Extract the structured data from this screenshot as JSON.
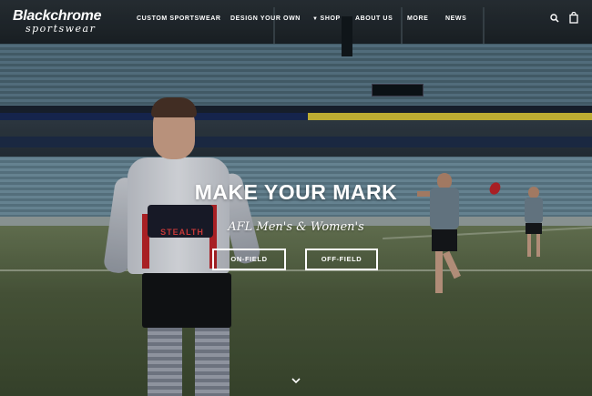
{
  "brand": {
    "name": "Blackchrome",
    "tagline": "sportswear"
  },
  "nav": {
    "items": [
      {
        "label": "CUSTOM SPORTSWEAR"
      },
      {
        "label": "DESIGN YOUR OWN"
      },
      {
        "label": "SHOP"
      },
      {
        "label": "ABOUT US"
      },
      {
        "label": "MORE"
      },
      {
        "label": "NEWS"
      }
    ],
    "icons": [
      "search-icon",
      "cart-icon"
    ]
  },
  "hero": {
    "title": "MAKE YOUR MARK",
    "subtitle": "AFL Men's & Women's",
    "buttons": [
      {
        "label": "ON-FIELD"
      },
      {
        "label": "OFF-FIELD"
      }
    ],
    "jersey_print": "STEALTH",
    "scroll_icon": "chevron-down-icon"
  },
  "colors": {
    "text": "#ffffff",
    "jersey_accent": "#c0252a"
  }
}
